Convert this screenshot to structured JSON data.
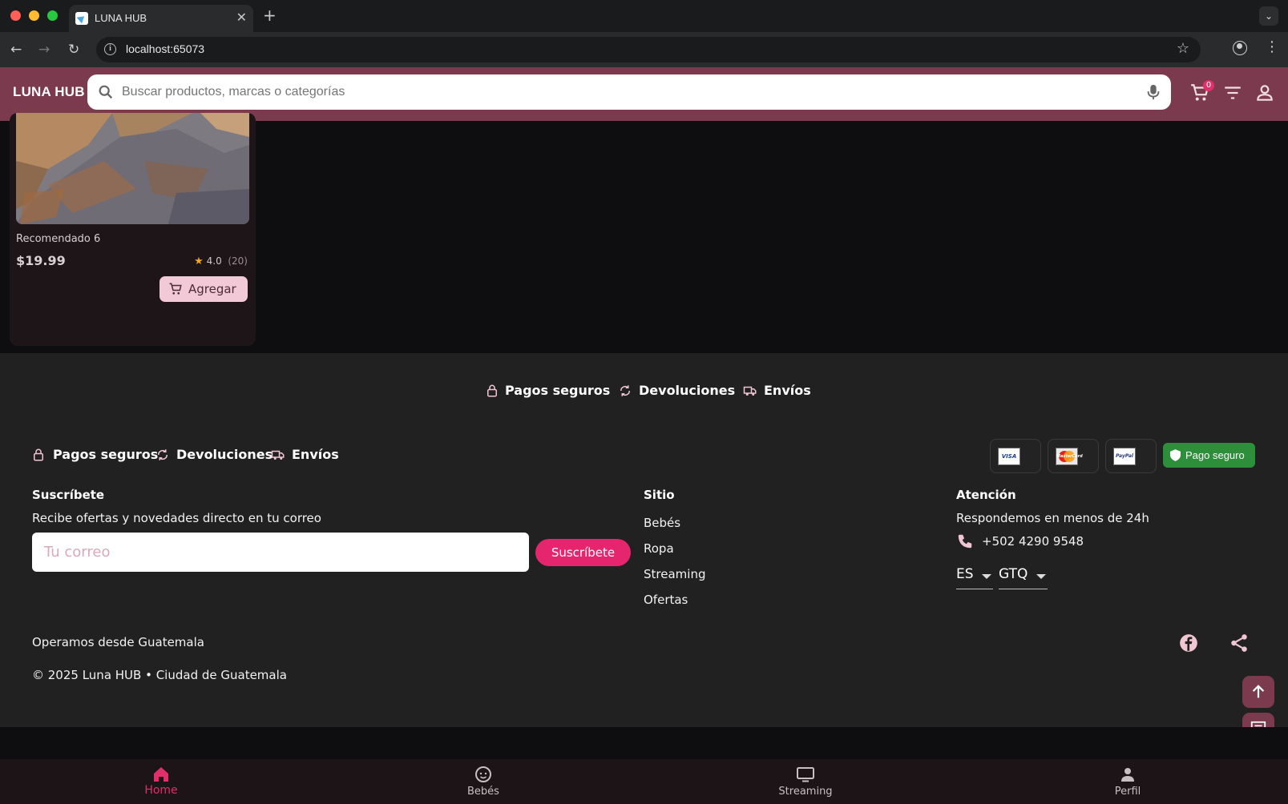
{
  "browser": {
    "tab_title": "LUNA HUB",
    "url": "localhost:65073"
  },
  "header": {
    "brand": "LUNA HUB",
    "search_placeholder": "Buscar productos, marcas o categorías",
    "cart_count": "0"
  },
  "product": {
    "title": "Recomendado 6",
    "price": "$19.99",
    "rating": "4.0",
    "reviews": "(20)",
    "add_label": "Agregar"
  },
  "footer": {
    "features_top": [
      {
        "label": "Pagos seguros",
        "icon": "lock-icon"
      },
      {
        "label": "Devoluciones",
        "icon": "refresh-icon"
      },
      {
        "label": "Envíos",
        "icon": "truck-icon"
      }
    ],
    "features_left": [
      {
        "label": "Pagos seguros",
        "icon": "lock-icon"
      },
      {
        "label": "Devoluciones",
        "icon": "refresh-icon"
      },
      {
        "label": "Envíos",
        "icon": "truck-icon"
      }
    ],
    "payment_logos": [
      "VISA",
      "MasterCard",
      "PayPal"
    ],
    "secure_badge": "Pago seguro",
    "subscribe": {
      "title": "Suscríbete",
      "text": "Recibe ofertas y novedades directo en tu correo",
      "placeholder": "Tu correo",
      "button": "Suscríbete"
    },
    "site": {
      "title": "Sitio",
      "links": [
        "Bebés",
        "Ropa",
        "Streaming",
        "Ofertas"
      ]
    },
    "attention": {
      "title": "Atención",
      "text": "Respondemos en menos de 24h",
      "phone": "+502 4290 9548",
      "language": "ES",
      "currency": "GTQ"
    },
    "location": "Operamos desde Guatemala",
    "copyright": "© 2025 Luna HUB • Ciudad de Guatemala"
  },
  "bottom_nav": [
    {
      "label": "Home",
      "icon": "home-icon",
      "active": true
    },
    {
      "label": "Bebés",
      "icon": "baby-face-icon",
      "active": false
    },
    {
      "label": "Streaming",
      "icon": "tv-icon",
      "active": false
    },
    {
      "label": "Perfil",
      "icon": "person-icon",
      "active": false
    }
  ],
  "colors": {
    "header": "#7c3a4f",
    "accent": "#e02f6b",
    "secure": "#2d8f3a",
    "footer_bg": "#212121"
  }
}
